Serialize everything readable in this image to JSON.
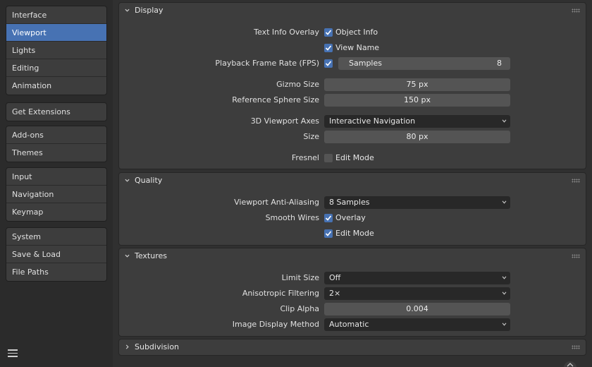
{
  "sidebar": {
    "groups": [
      [
        "Interface",
        "Viewport",
        "Lights",
        "Editing",
        "Animation"
      ],
      [
        "Get Extensions"
      ],
      [
        "Add-ons",
        "Themes"
      ],
      [
        "Input",
        "Navigation",
        "Keymap"
      ],
      [
        "System",
        "Save & Load",
        "File Paths"
      ]
    ],
    "active": "Viewport",
    "menu_icon": "hamburger-icon"
  },
  "display": {
    "title": "Display",
    "text_info_overlay": {
      "label": "Text Info Overlay",
      "object_info": "Object Info",
      "view_name": "View Name"
    },
    "playback": {
      "label": "Playback Frame Rate (FPS)",
      "samples_label": "Samples",
      "samples_value": "8"
    },
    "gizmo_size": {
      "label": "Gizmo Size",
      "value": "75 px"
    },
    "reference_sphere": {
      "label": "Reference Sphere Size",
      "value": "150 px"
    },
    "axes": {
      "label": "3D Viewport Axes",
      "value": "Interactive Navigation"
    },
    "size": {
      "label": "Size",
      "value": "80 px"
    },
    "fresnel": {
      "label": "Fresnel",
      "edit_mode": "Edit Mode"
    }
  },
  "quality": {
    "title": "Quality",
    "anti_aliasing": {
      "label": "Viewport Anti-Aliasing",
      "value": "8 Samples"
    },
    "smooth_wires": {
      "label": "Smooth Wires",
      "overlay": "Overlay",
      "edit_mode": "Edit Mode"
    }
  },
  "textures": {
    "title": "Textures",
    "limit_size": {
      "label": "Limit Size",
      "value": "Off"
    },
    "anisotropic": {
      "label": "Anisotropic Filtering",
      "value": "2×"
    },
    "clip_alpha": {
      "label": "Clip Alpha",
      "value": "0.004"
    },
    "image_display": {
      "label": "Image Display Method",
      "value": "Automatic"
    }
  },
  "subdivision": {
    "title": "Subdivision"
  },
  "colors": {
    "accent": "#4772b3",
    "panel": "#3d3d3d",
    "field": "#545454",
    "dropdown": "#282828"
  }
}
